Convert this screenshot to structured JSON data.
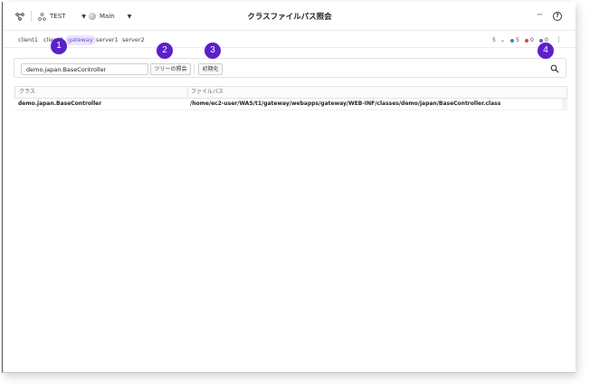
{
  "header": {
    "project": "TEST",
    "branch": "Main",
    "title": "クラスファイルパス照会",
    "more_glyph": "···",
    "help_glyph": "?"
  },
  "tabs": [
    {
      "label": "client1",
      "active": false
    },
    {
      "label": "client2",
      "active": false
    },
    {
      "label": "gateway",
      "active": true
    },
    {
      "label": "server1",
      "active": false
    },
    {
      "label": "server2",
      "active": false
    }
  ],
  "status": {
    "count": "5",
    "blue_count": "5",
    "red_count": "0",
    "purple_count": "0",
    "colors": {
      "blue": "#3b7ddd",
      "red": "#e0413a",
      "purple": "#7a55d6"
    }
  },
  "search": {
    "value": "demo.japan.BaseController",
    "tree_button": "ツリーの照会",
    "reset_button": "初期化"
  },
  "table": {
    "columns": [
      "クラス",
      "ファイルパス"
    ],
    "rows": [
      {
        "class": "demo.japan.BaseController",
        "path": "/home/ec2-user/WAS/t1/gateway/webapps/gateway/WEB-INF/classes/demo/japan/BaseController.class"
      }
    ]
  },
  "markers": [
    "1",
    "2",
    "3",
    "4"
  ],
  "accent": "#5b20c9"
}
